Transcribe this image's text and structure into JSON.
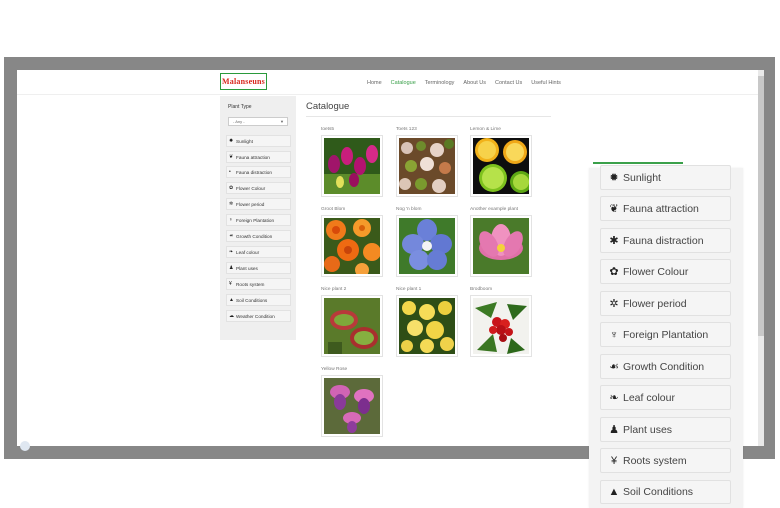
{
  "header": {
    "logo_text": "Malanseuns",
    "nav": [
      "Home",
      "Catalogue",
      "Terminology",
      "About Us",
      "Contact Us",
      "Useful Hints"
    ],
    "active_nav": "Catalogue"
  },
  "sidebar": {
    "title": "Plant Type",
    "select_value": "- Any -",
    "items": [
      {
        "label": "Sunlight",
        "icon": "sun-icon"
      },
      {
        "label": "Fauna attraction",
        "icon": "leaf-icon"
      },
      {
        "label": "Fauna distraction",
        "icon": "bug-icon"
      },
      {
        "label": "Flower Colour",
        "icon": "flower-icon"
      },
      {
        "label": "Flower period",
        "icon": "gear-flower-icon"
      },
      {
        "label": "Foreign Plantation",
        "icon": "plant-icon"
      },
      {
        "label": "Growth Condition",
        "icon": "hand-plant-icon"
      },
      {
        "label": "Leaf colour",
        "icon": "leaves-icon"
      },
      {
        "label": "Plant uses",
        "icon": "pot-icon"
      },
      {
        "label": "Roots system",
        "icon": "roots-icon"
      },
      {
        "label": "Soil Conditions",
        "icon": "soil-icon"
      },
      {
        "label": "Weather Condition",
        "icon": "weather-icon"
      }
    ]
  },
  "catalogue": {
    "title": "Catalogue",
    "items": [
      {
        "caption": "toets5",
        "image": "pink-tulips"
      },
      {
        "caption": "Toets 123",
        "image": "abelia-shrub"
      },
      {
        "caption": "Lemon & Lime",
        "image": "citrus-slices"
      },
      {
        "caption": "Groot Blom",
        "image": "orange-dahlias"
      },
      {
        "caption": "Nog 'n blom",
        "image": "blue-flower"
      },
      {
        "caption": "Another example plant",
        "image": "pink-lotus"
      },
      {
        "caption": "Nice plant 2",
        "image": "venus-flytrap"
      },
      {
        "caption": "Nice plant 1",
        "image": "yellow-roses"
      },
      {
        "caption": "Brodboom",
        "image": "red-berries"
      },
      {
        "caption": "Yellow Rose",
        "image": "fuchsia-flowers"
      }
    ]
  },
  "zoom_panel": {
    "items": [
      {
        "label": "Sunlight",
        "icon": "sun-icon"
      },
      {
        "label": "Fauna attraction",
        "icon": "leaf-icon"
      },
      {
        "label": "Fauna distraction",
        "icon": "bug-icon"
      },
      {
        "label": "Flower Colour",
        "icon": "flower-icon"
      },
      {
        "label": "Flower period",
        "icon": "gear-flower-icon"
      },
      {
        "label": "Foreign Plantation",
        "icon": "plant-icon"
      },
      {
        "label": "Growth Condition",
        "icon": "hand-plant-icon"
      },
      {
        "label": "Leaf colour",
        "icon": "leaves-icon"
      },
      {
        "label": "Plant uses",
        "icon": "pot-icon"
      },
      {
        "label": "Roots system",
        "icon": "roots-icon"
      },
      {
        "label": "Soil Conditions",
        "icon": "soil-icon"
      }
    ]
  },
  "colors": {
    "accent": "#3aa04a",
    "logo_red": "#d8261c",
    "frame": "#878787"
  }
}
